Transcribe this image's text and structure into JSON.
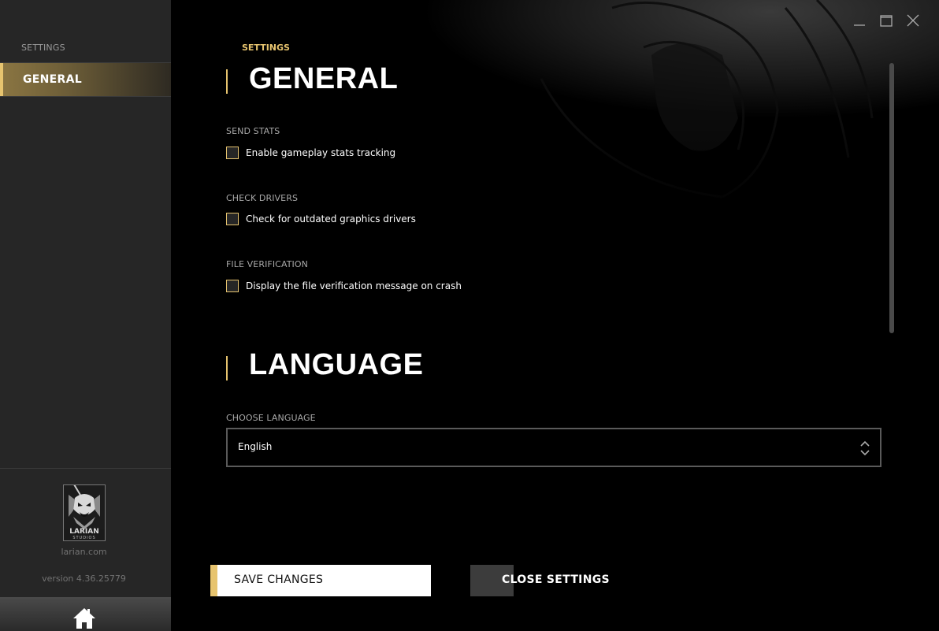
{
  "sidebar": {
    "heading": "SETTINGS",
    "items": [
      {
        "label": "GENERAL",
        "active": true
      }
    ],
    "logo_text": "LARIAN",
    "logo_sub": "STUDIOS",
    "site": "larian.com",
    "version": "version 4.36.25779"
  },
  "main": {
    "breadcrumb": "SETTINGS",
    "sections": {
      "general": {
        "title": "GENERAL",
        "send_stats": {
          "label": "SEND STATS",
          "option": "Enable gameplay stats tracking",
          "checked": false
        },
        "check_drivers": {
          "label": "CHECK DRIVERS",
          "option": "Check for outdated graphics drivers",
          "checked": false
        },
        "file_verification": {
          "label": "FILE VERIFICATION",
          "option": "Display the file verification message on crash",
          "checked": false
        }
      },
      "language": {
        "title": "LANGUAGE",
        "choose_label": "CHOOSE LANGUAGE",
        "selected": "English"
      }
    },
    "buttons": {
      "save": "SAVE CHANGES",
      "close": "CLOSE SETTINGS"
    }
  },
  "colors": {
    "accent": "#e7c46f",
    "sidebar_bg": "#262626",
    "main_bg": "#000000"
  },
  "icons": [
    "minimize-icon",
    "maximize-icon",
    "close-icon",
    "home-icon",
    "select-arrows-icon"
  ]
}
